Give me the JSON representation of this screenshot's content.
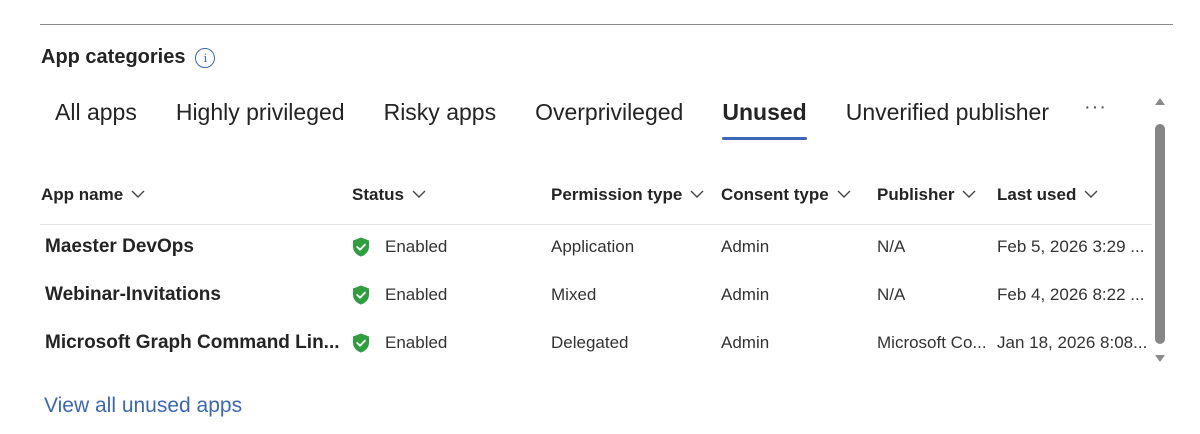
{
  "section": {
    "title": "App categories",
    "info_icon": "info-icon"
  },
  "tabs": [
    {
      "label": "All apps",
      "active": false
    },
    {
      "label": "Highly privileged",
      "active": false
    },
    {
      "label": "Risky apps",
      "active": false
    },
    {
      "label": "Overprivileged",
      "active": false
    },
    {
      "label": "Unused",
      "active": true
    },
    {
      "label": "Unverified publisher",
      "active": false
    }
  ],
  "tabs_more": "···",
  "table": {
    "columns": [
      "App name",
      "Status",
      "Permission type",
      "Consent type",
      "Publisher",
      "Last used"
    ],
    "rows": [
      {
        "app_name": "Maester DevOps",
        "status": "Enabled",
        "permission_type": "Application",
        "consent_type": "Admin",
        "publisher": "N/A",
        "last_used": "Feb 5, 2026 3:29 ..."
      },
      {
        "app_name": "Webinar-Invitations",
        "status": "Enabled",
        "permission_type": "Mixed",
        "consent_type": "Admin",
        "publisher": "N/A",
        "last_used": "Feb 4, 2026 8:22 ..."
      },
      {
        "app_name": "Microsoft Graph Command Lin...",
        "status": "Enabled",
        "permission_type": "Delegated",
        "consent_type": "Admin",
        "publisher": "Microsoft Co...",
        "last_used": "Jan 18, 2026 8:08..."
      }
    ]
  },
  "link": {
    "view_all": "View all unused apps"
  },
  "colors": {
    "accent": "#3b68b5",
    "status_enabled": "#2e9e3e",
    "text": "#242424"
  }
}
